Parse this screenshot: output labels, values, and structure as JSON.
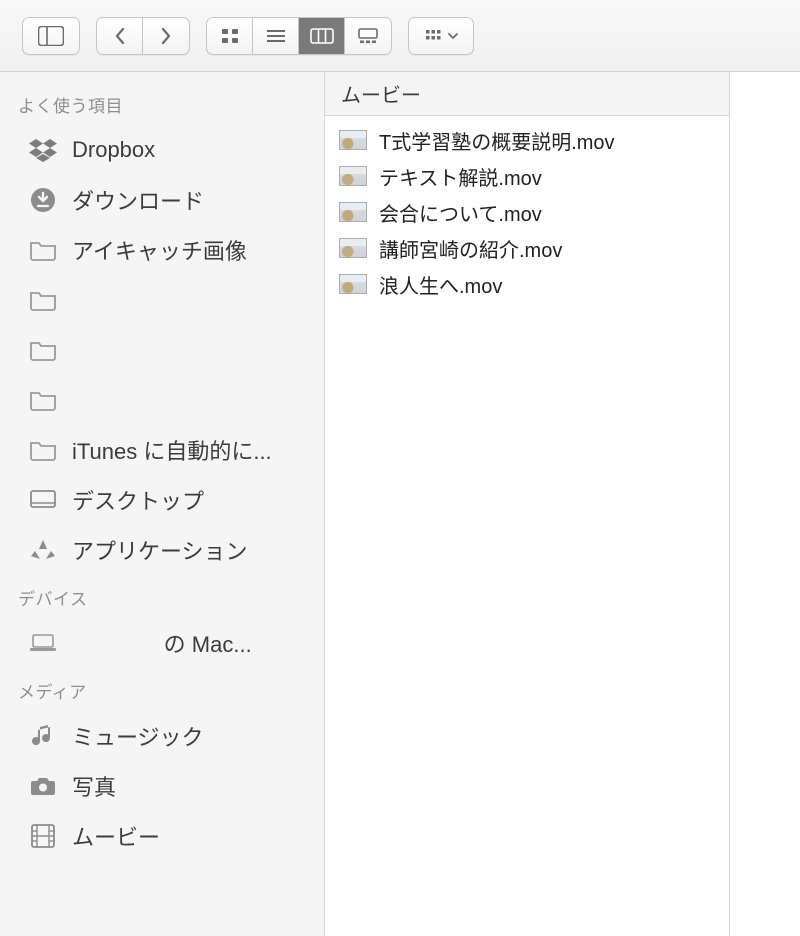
{
  "column_title": "ムービー",
  "sidebar": {
    "sections": [
      {
        "title": "よく使う項目",
        "items": [
          {
            "icon": "dropbox",
            "label": "Dropbox"
          },
          {
            "icon": "download",
            "label": "ダウンロード"
          },
          {
            "icon": "folder",
            "label": "アイキャッチ画像"
          },
          {
            "icon": "folder",
            "label": ""
          },
          {
            "icon": "folder",
            "label": ""
          },
          {
            "icon": "folder",
            "label": ""
          },
          {
            "icon": "folder",
            "label": "iTunes に自動的に..."
          },
          {
            "icon": "desktop",
            "label": "デスクトップ"
          },
          {
            "icon": "apps",
            "label": "アプリケーション"
          }
        ]
      },
      {
        "title": "デバイス",
        "items": [
          {
            "icon": "laptop",
            "label": "               の Mac..."
          }
        ]
      },
      {
        "title": "メディア",
        "items": [
          {
            "icon": "music",
            "label": "ミュージック"
          },
          {
            "icon": "camera",
            "label": "写真"
          },
          {
            "icon": "film",
            "label": "ムービー"
          }
        ]
      }
    ]
  },
  "files": [
    {
      "name": "T式学習塾の概要説明.mov"
    },
    {
      "name": "テキスト解説.mov"
    },
    {
      "name": "会合について.mov"
    },
    {
      "name": "講師宮崎の紹介.mov"
    },
    {
      "name": "浪人生へ.mov"
    }
  ]
}
